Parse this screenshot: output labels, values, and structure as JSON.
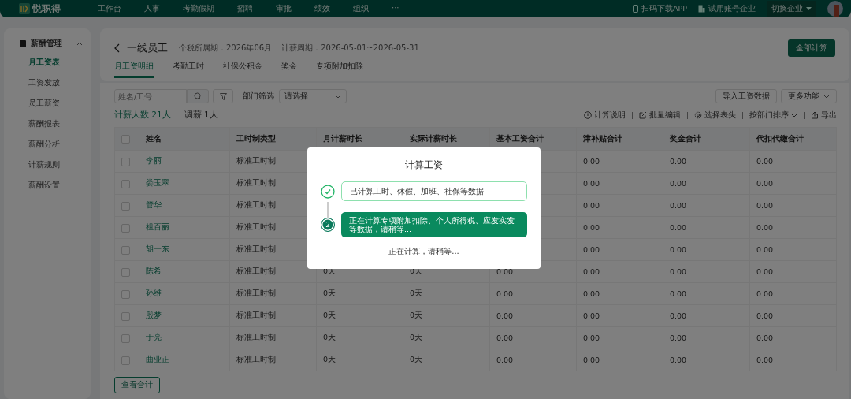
{
  "topbar": {
    "logo": "悦职得",
    "nav": [
      {
        "label": "工作台"
      },
      {
        "label": "人事"
      },
      {
        "label": "考勤假期"
      },
      {
        "label": "招聘"
      },
      {
        "label": "审批"
      },
      {
        "label": "绩效"
      },
      {
        "label": "组织"
      },
      {
        "label": "···"
      }
    ],
    "download": "扫码下载APP",
    "company": "试用账号企业",
    "switch": "切换企业"
  },
  "sidebar": {
    "group": "薪酬管理",
    "expanded": true,
    "items": [
      {
        "label": "月工资表",
        "selected": true
      },
      {
        "label": "工资发放",
        "selected": false
      },
      {
        "label": "员工薪资",
        "selected": false
      },
      {
        "label": "薪酬报表",
        "selected": false
      },
      {
        "label": "薪酬分析",
        "selected": false
      },
      {
        "label": "计薪规则",
        "selected": false
      },
      {
        "label": "薪酬设置",
        "selected": false
      }
    ]
  },
  "header": {
    "title": "一线员工",
    "tax_period": "个税所属期：2026年06月",
    "pay_period": "计薪周期：2026-05-01~2026-05-31",
    "calc_button": "全部计算"
  },
  "tabs": [
    {
      "label": "月工资明细",
      "selected": true
    },
    {
      "label": "考勤工时",
      "selected": false
    },
    {
      "label": "社保公积金",
      "selected": false
    },
    {
      "label": "奖金",
      "selected": false
    },
    {
      "label": "专项附加扣除",
      "selected": false
    }
  ],
  "toolbar": {
    "search": {
      "placeholder": "姓名/工号"
    },
    "dept_label": "部门筛选",
    "dept_select": "请选择",
    "import_button": "导入工资数据",
    "more_button": "更多功能"
  },
  "stats": [
    {
      "label": "计薪人数 21人",
      "kind": "primary"
    },
    {
      "label": "调薪 1人",
      "kind": "plain"
    }
  ],
  "actions": [
    {
      "label": "计算说明",
      "kind": "info"
    },
    {
      "label": "批量编辑",
      "kind": "edit"
    },
    {
      "label": "选择表头",
      "kind": "gear"
    },
    {
      "label": "按部门排序",
      "kind": "sort"
    },
    {
      "label": "导出",
      "kind": "export"
    }
  ],
  "table": {
    "all_checked": false,
    "columns": [
      "姓名",
      "工时制类型",
      "月计薪时长",
      "实际计薪时长",
      "基本工资合计",
      "津补贴合计",
      "奖金合计",
      "代扣代缴合计"
    ],
    "rows": [
      {
        "checked": false,
        "cells": [
          "李丽",
          "标准工时制",
          null,
          null,
          null,
          "0.00",
          "0.00",
          "0.00"
        ]
      },
      {
        "checked": false,
        "cells": [
          "娄玉翠",
          "标准工时制",
          null,
          null,
          null,
          "0.00",
          "0.00",
          "0.00"
        ]
      },
      {
        "checked": false,
        "cells": [
          "管华",
          "标准工时制",
          null,
          null,
          null,
          "0.00",
          "0.00",
          "0.00"
        ]
      },
      {
        "checked": false,
        "cells": [
          "祖百丽",
          "标准工时制",
          null,
          null,
          null,
          "0.00",
          "0.00",
          "0.00"
        ]
      },
      {
        "checked": false,
        "cells": [
          "胡一东",
          "标准工时制",
          null,
          null,
          null,
          "0.00",
          "0.00",
          "0.00"
        ]
      },
      {
        "checked": false,
        "cells": [
          "陈希",
          "标准工时制",
          "0天",
          "0天",
          "0.00",
          "0.00",
          "0.00",
          "0.00"
        ]
      },
      {
        "checked": false,
        "cells": [
          "孙维",
          "标准工时制",
          "0天",
          "0天",
          "0.00",
          "0.00",
          "0.00",
          "0.00"
        ]
      },
      {
        "checked": false,
        "cells": [
          "殷梦",
          "标准工时制",
          "0天",
          "0天",
          "0.00",
          "0.00",
          "0.00",
          "0.00"
        ]
      },
      {
        "checked": false,
        "cells": [
          "于亮",
          "标准工时制",
          "0天",
          "0天",
          "0.00",
          "0.00",
          "0.00",
          "0.00"
        ]
      },
      {
        "checked": false,
        "cells": [
          "曲业正",
          "标准工时制",
          "0天",
          "0天",
          "0.00",
          "0.00",
          "0.00",
          "0.00"
        ]
      }
    ],
    "total_button": "查看合计"
  },
  "modal": {
    "title": "计算工资",
    "steps": [
      {
        "kind": "done",
        "text": "已计算工时、休假、加班、社保等数据"
      },
      {
        "kind": "active",
        "number": "2",
        "text": "正在计算专项附加扣除、个人所得税、应发实发等数据，请稍等..."
      }
    ],
    "footer": "正在计算，请稍等..."
  }
}
